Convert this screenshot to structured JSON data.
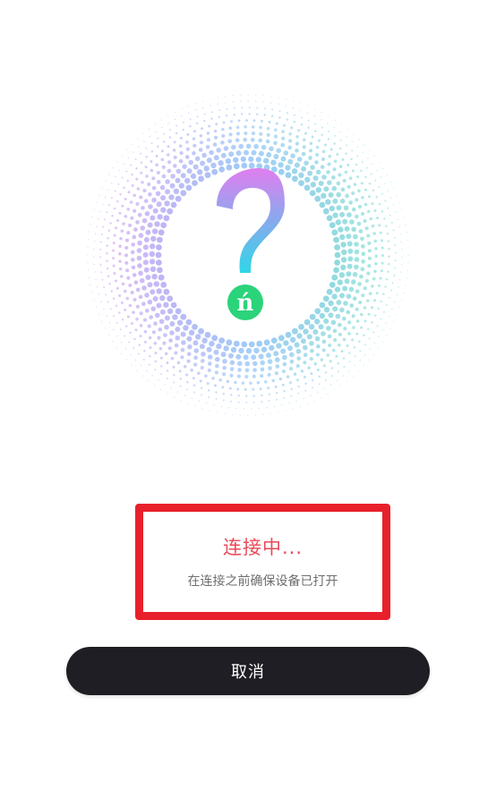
{
  "hero": {
    "logo_letter": "ń",
    "colors": {
      "dots_left": "#d89cf2",
      "dots_mid": "#9cc8f8",
      "dots_right": "#7fe6c8",
      "question_top": "#e07ef0",
      "question_bottom": "#2fd6e8",
      "logo_badge": "#2bd37a"
    }
  },
  "status": {
    "title": "连接中...",
    "hint": "在连接之前确保设备已打开"
  },
  "actions": {
    "cancel_label": "取消"
  }
}
